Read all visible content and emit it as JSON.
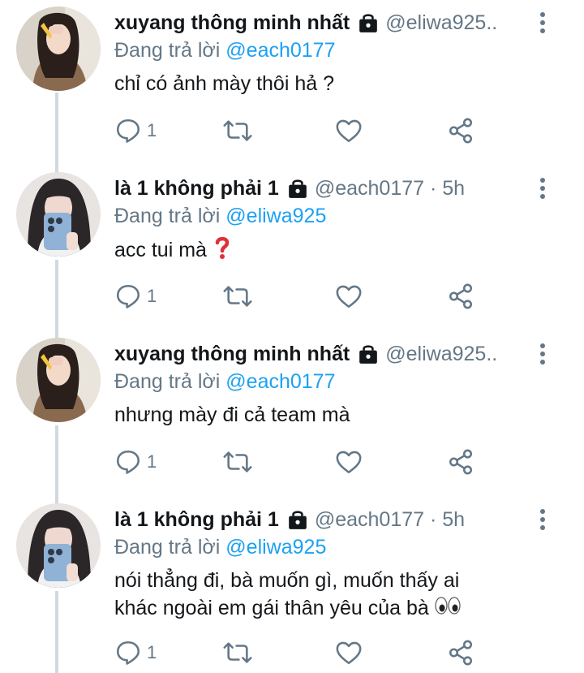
{
  "tweets": [
    {
      "display_name": "xuyang thông minh nhất",
      "handle": "@eliwa925..",
      "replying_prefix": "Đang trả lời ",
      "replying_to": "@each0177",
      "text": "chỉ có ảnh mày thôi hả ?",
      "reply_count": "1",
      "avatar": "girl-sweater-avatar"
    },
    {
      "display_name": "là 1 không phải 1",
      "handle": "@each0177 · 5h",
      "replying_prefix": "Đang trả lời ",
      "replying_to": "@eliwa925",
      "text": "acc tui mà",
      "text_emoji": "❓",
      "reply_count": "1",
      "avatar": "girl-phone-avatar"
    },
    {
      "display_name": "xuyang thông minh nhất",
      "handle": "@eliwa925..",
      "replying_prefix": "Đang trả lời ",
      "replying_to": "@each0177",
      "text": "nhưng mày đi cả team mà",
      "reply_count": "1",
      "avatar": "girl-sweater-avatar"
    },
    {
      "display_name": "là 1 không phải 1",
      "handle": "@each0177 · 5h",
      "replying_prefix": "Đang trả lời ",
      "replying_to": "@eliwa925",
      "text": "nói thẳng đi, bà muốn gì, muốn thấy ai\nkhác ngoài em gái thân yêu của bà",
      "text_emoji": "👀",
      "reply_count": "1",
      "avatar": "girl-phone-avatar"
    }
  ],
  "colors": {
    "text": "#14171a",
    "secondary": "#657786",
    "mention": "#1da1f2",
    "thread_line": "#cfd9de"
  },
  "icons": [
    "lock-icon",
    "more-vertical-icon",
    "reply-icon",
    "retweet-icon",
    "like-icon",
    "share-icon",
    "red-question-mark-emoji",
    "eyes-emoji"
  ]
}
